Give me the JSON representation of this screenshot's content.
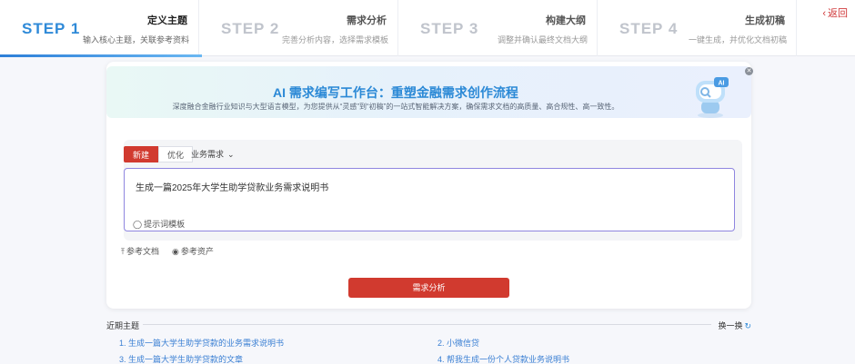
{
  "steps": [
    {
      "num": "STEP 1",
      "title": "定义主题",
      "sub": "输入核心主题，关联参考资料",
      "active": true
    },
    {
      "num": "STEP 2",
      "title": "需求分析",
      "sub": "完善分析内容，选择需求模板",
      "active": false
    },
    {
      "num": "STEP 3",
      "title": "构建大纲",
      "sub": "调整并确认最终文档大纲",
      "active": false
    },
    {
      "num": "STEP 4",
      "title": "生成初稿",
      "sub": "一键生成，并优化文档初稿",
      "active": false
    }
  ],
  "back_label": "返回",
  "banner": {
    "title": "AI 需求编写工作台：重塑金融需求创作流程",
    "subtitle": "深度融合金融行业知识与大型语言模型，为您提供从“灵感”到“初稿”的一站式智能解决方案，确保需求文档的高质量、高合规性、高一致性。",
    "robot_text": "AI"
  },
  "editor": {
    "tab_new": "新建",
    "tab_optimize": "优化",
    "category": "业务需求",
    "prompt_value": "生成一篇2025年大学生助学贷款业务需求说明书",
    "template_link": "提示词模板"
  },
  "refs": {
    "doc": "参考文档",
    "asset": "参考资产"
  },
  "analyze_button": "需求分析",
  "recent": {
    "label": "近期主题",
    "refresh": "换一换",
    "items": [
      "1. 生成一篇大学生助学贷款的业务需求说明书",
      "2. 小微信贷",
      "3. 生成一篇大学生助学贷款的文章",
      "4. 帮我生成一份个人贷款业务说明书"
    ]
  },
  "colors": {
    "accent_blue": "#2f8ad8",
    "primary_red": "#d13a2f",
    "link_blue": "#3a7fd3"
  }
}
